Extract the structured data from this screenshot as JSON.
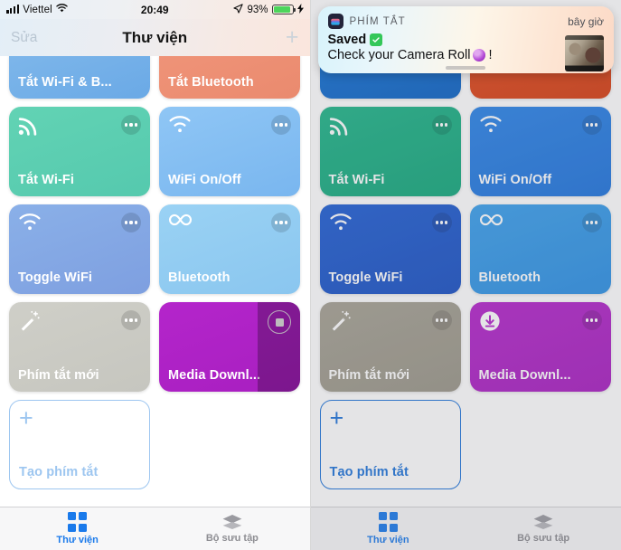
{
  "status_bar": {
    "carrier": "Viettel",
    "time": "20:49",
    "battery_percent": "93%",
    "battery_level": 93
  },
  "nav": {
    "edit": "Sửa",
    "title": "Thư viện",
    "add": "+"
  },
  "notification": {
    "app_name": "PHÍM TẮT",
    "time": "bây giờ",
    "title": "Saved",
    "body": "Check your Camera Roll",
    "body_suffix": "!"
  },
  "tabs": [
    {
      "label": "Thư viện",
      "icon": "grid-icon",
      "active": true
    },
    {
      "label": "Bộ sưu tập",
      "icon": "layers-icon",
      "active": false
    }
  ],
  "left_panel": {
    "accent": "#1a7aeb",
    "create_border": "#9dc6f0",
    "tiles": [
      {
        "label": "Tắt Wi-Fi & B...",
        "icon": "none",
        "partial": true,
        "color_a": "#7db6ea",
        "color_b": "#6aa9e6",
        "badge": "none"
      },
      {
        "label": "Tắt Bluetooth",
        "icon": "none",
        "partial": true,
        "color_a": "#ef9378",
        "color_b": "#ea8a6e",
        "badge": "none"
      },
      {
        "label": "Tắt Wi-Fi",
        "icon": "rss-icon",
        "partial": false,
        "color_a": "#62d3b4",
        "color_b": "#55c9ae",
        "badge": "dots"
      },
      {
        "label": "WiFi On/Off",
        "icon": "wifi-icon",
        "partial": false,
        "color_a": "#8fc6f5",
        "color_b": "#79b6ef",
        "badge": "dots"
      },
      {
        "label": "Toggle WiFi",
        "icon": "wifi-icon",
        "partial": false,
        "color_a": "#8ab0e8",
        "color_b": "#7e9fe0",
        "badge": "dots"
      },
      {
        "label": "Bluetooth",
        "icon": "infinity-icon",
        "partial": false,
        "color_a": "#9ad2f4",
        "color_b": "#8ac6ef",
        "badge": "dots"
      },
      {
        "label": "Phím tắt mới",
        "icon": "wand-icon",
        "partial": false,
        "color_a": "#cfcfc8",
        "color_b": "#c6c6bf",
        "badge": "dots"
      },
      {
        "label": "Media Downl...",
        "icon": "none",
        "partial": false,
        "color_a": "#b425cb",
        "color_b": "#a81fc0",
        "badge": "stop",
        "running": true
      }
    ],
    "create_label": "Tạo phím tắt"
  },
  "right_panel": {
    "accent": "#1a7aeb",
    "create_border": "#2075da",
    "tiles": [
      {
        "label": "",
        "icon": "none",
        "partial": true,
        "color_a": "#1170d4",
        "color_b": "#0c63c4",
        "badge": "none"
      },
      {
        "label": "",
        "icon": "none",
        "partial": true,
        "color_a": "#e0471a",
        "color_b": "#d63e12",
        "badge": "none"
      },
      {
        "label": "Tắt Wi-Fi",
        "icon": "rss-icon",
        "partial": false,
        "color_a": "#1fb589",
        "color_b": "#14a87c",
        "badge": "dots"
      },
      {
        "label": "WiFi On/Off",
        "icon": "wifi-icon",
        "partial": false,
        "color_a": "#2b84e8",
        "color_b": "#1f74dd",
        "badge": "dots"
      },
      {
        "label": "Toggle WiFi",
        "icon": "wifi-icon",
        "partial": false,
        "color_a": "#1f5fd4",
        "color_b": "#1a51c4",
        "badge": "dots"
      },
      {
        "label": "Bluetooth",
        "icon": "infinity-icon",
        "partial": false,
        "color_a": "#3ba0ec",
        "color_b": "#2c90e4",
        "badge": "dots"
      },
      {
        "label": "Phím tắt mới",
        "icon": "wand-icon",
        "partial": false,
        "color_a": "#a6a294",
        "color_b": "#9b9789",
        "badge": "dots"
      },
      {
        "label": "Media Downl...",
        "icon": "download-icon",
        "partial": false,
        "color_a": "#b425cb",
        "color_b": "#a81fc0",
        "badge": "dots"
      }
    ],
    "create_label": "Tạo phím tắt"
  }
}
